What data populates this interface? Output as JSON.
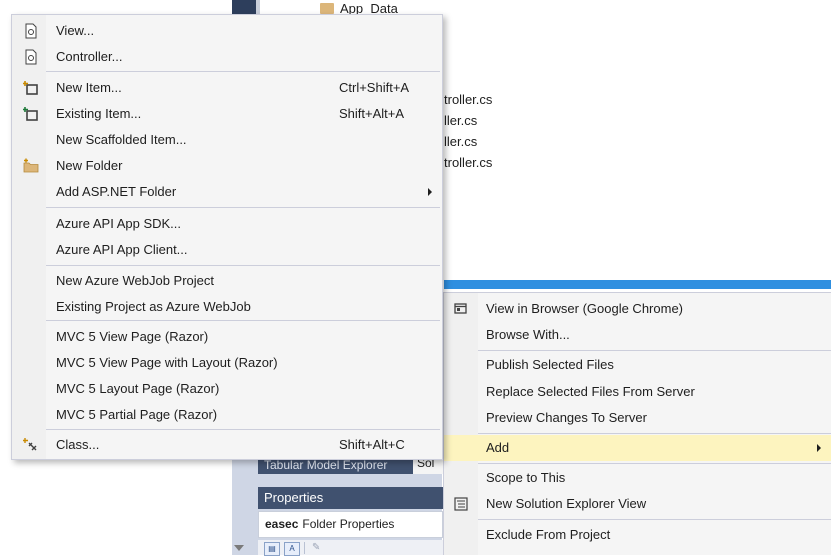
{
  "background": {
    "folder_name": "App_Data",
    "files": [
      "troller.cs",
      "ller.cs",
      "ller.cs",
      "troller.cs"
    ],
    "tabs": {
      "tabular": "Tabular Model Explorer",
      "selected": "Sol"
    },
    "properties_title": "Properties",
    "properties_object": "easec",
    "properties_type": "Folder Properties"
  },
  "add_submenu": {
    "items": [
      {
        "label": "View...",
        "icon": "view-file-icon"
      },
      {
        "label": "Controller...",
        "icon": "controller-file-icon"
      },
      {
        "label": "New Item...",
        "shortcut": "Ctrl+Shift+A",
        "icon": "new-item-icon"
      },
      {
        "label": "Existing Item...",
        "shortcut": "Shift+Alt+A",
        "icon": "existing-item-icon"
      },
      {
        "label": "New Scaffolded Item..."
      },
      {
        "label": "New Folder",
        "icon": "new-folder-icon"
      },
      {
        "label": "Add ASP.NET Folder",
        "has_submenu": true
      },
      {
        "label": "Azure API App SDK..."
      },
      {
        "label": "Azure API App Client..."
      },
      {
        "label": "New Azure WebJob Project"
      },
      {
        "label": "Existing Project as Azure WebJob"
      },
      {
        "label": "MVC 5 View Page (Razor)"
      },
      {
        "label": "MVC 5 View Page with Layout (Razor)"
      },
      {
        "label": "MVC 5 Layout Page (Razor)"
      },
      {
        "label": "MVC 5 Partial Page (Razor)"
      },
      {
        "label": "Class...",
        "shortcut": "Shift+Alt+C",
        "icon": "class-icon"
      }
    ]
  },
  "context_menu": {
    "items": [
      {
        "label": "View in Browser (Google Chrome)",
        "icon": "browser-icon"
      },
      {
        "label": "Browse With..."
      },
      {
        "label": "Publish Selected Files"
      },
      {
        "label": "Replace Selected Files From Server"
      },
      {
        "label": "Preview Changes To Server"
      },
      {
        "label": "Add",
        "has_submenu": true,
        "highlighted": true
      },
      {
        "label": "Scope to This"
      },
      {
        "label": "New Solution Explorer View",
        "icon": "solution-view-icon"
      },
      {
        "label": "Exclude From Project"
      }
    ]
  },
  "colors": {
    "menu_bg": "#f5f5f5",
    "highlight": "#fdf4bf",
    "title_bar": "#40516f",
    "accent_blue": "#2f8fe0"
  }
}
